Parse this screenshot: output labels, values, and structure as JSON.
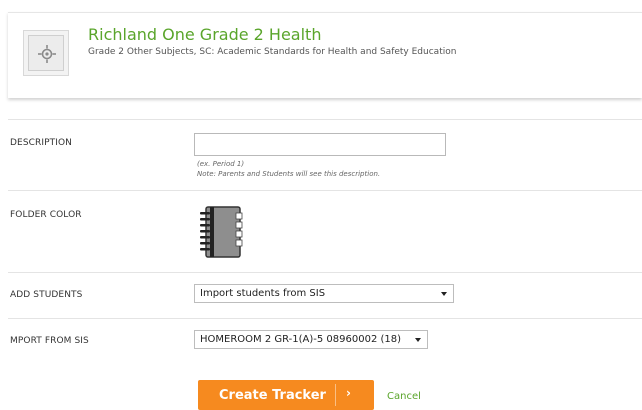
{
  "course": {
    "title": "Richland One Grade 2 Health",
    "subtitle": "Grade 2 Other Subjects, SC: Academic Standards for Health and Safety Education",
    "icon": "course-gear-icon"
  },
  "form": {
    "description": {
      "label": "DESCRIPTION",
      "value": "",
      "hint_example": "(ex. Period 1)",
      "hint_note": "Note: Parents and Students will see this description."
    },
    "folder_color": {
      "label": "FOLDER COLOR",
      "icon": "folder-binder-icon",
      "color": "#8e8e8e"
    },
    "add_students": {
      "label": "ADD STUDENTS",
      "selected": "Import students from SIS"
    },
    "import_from_sis": {
      "label": "MPORT FROM SIS",
      "selected": "HOMEROOM 2 GR-1(A)-5 08960002 (18)"
    }
  },
  "actions": {
    "create_label": "Create Tracker",
    "create_chevron": "›",
    "cancel_label": "Cancel",
    "accent_color": "#f68a1f",
    "link_color": "#5aa52b"
  }
}
